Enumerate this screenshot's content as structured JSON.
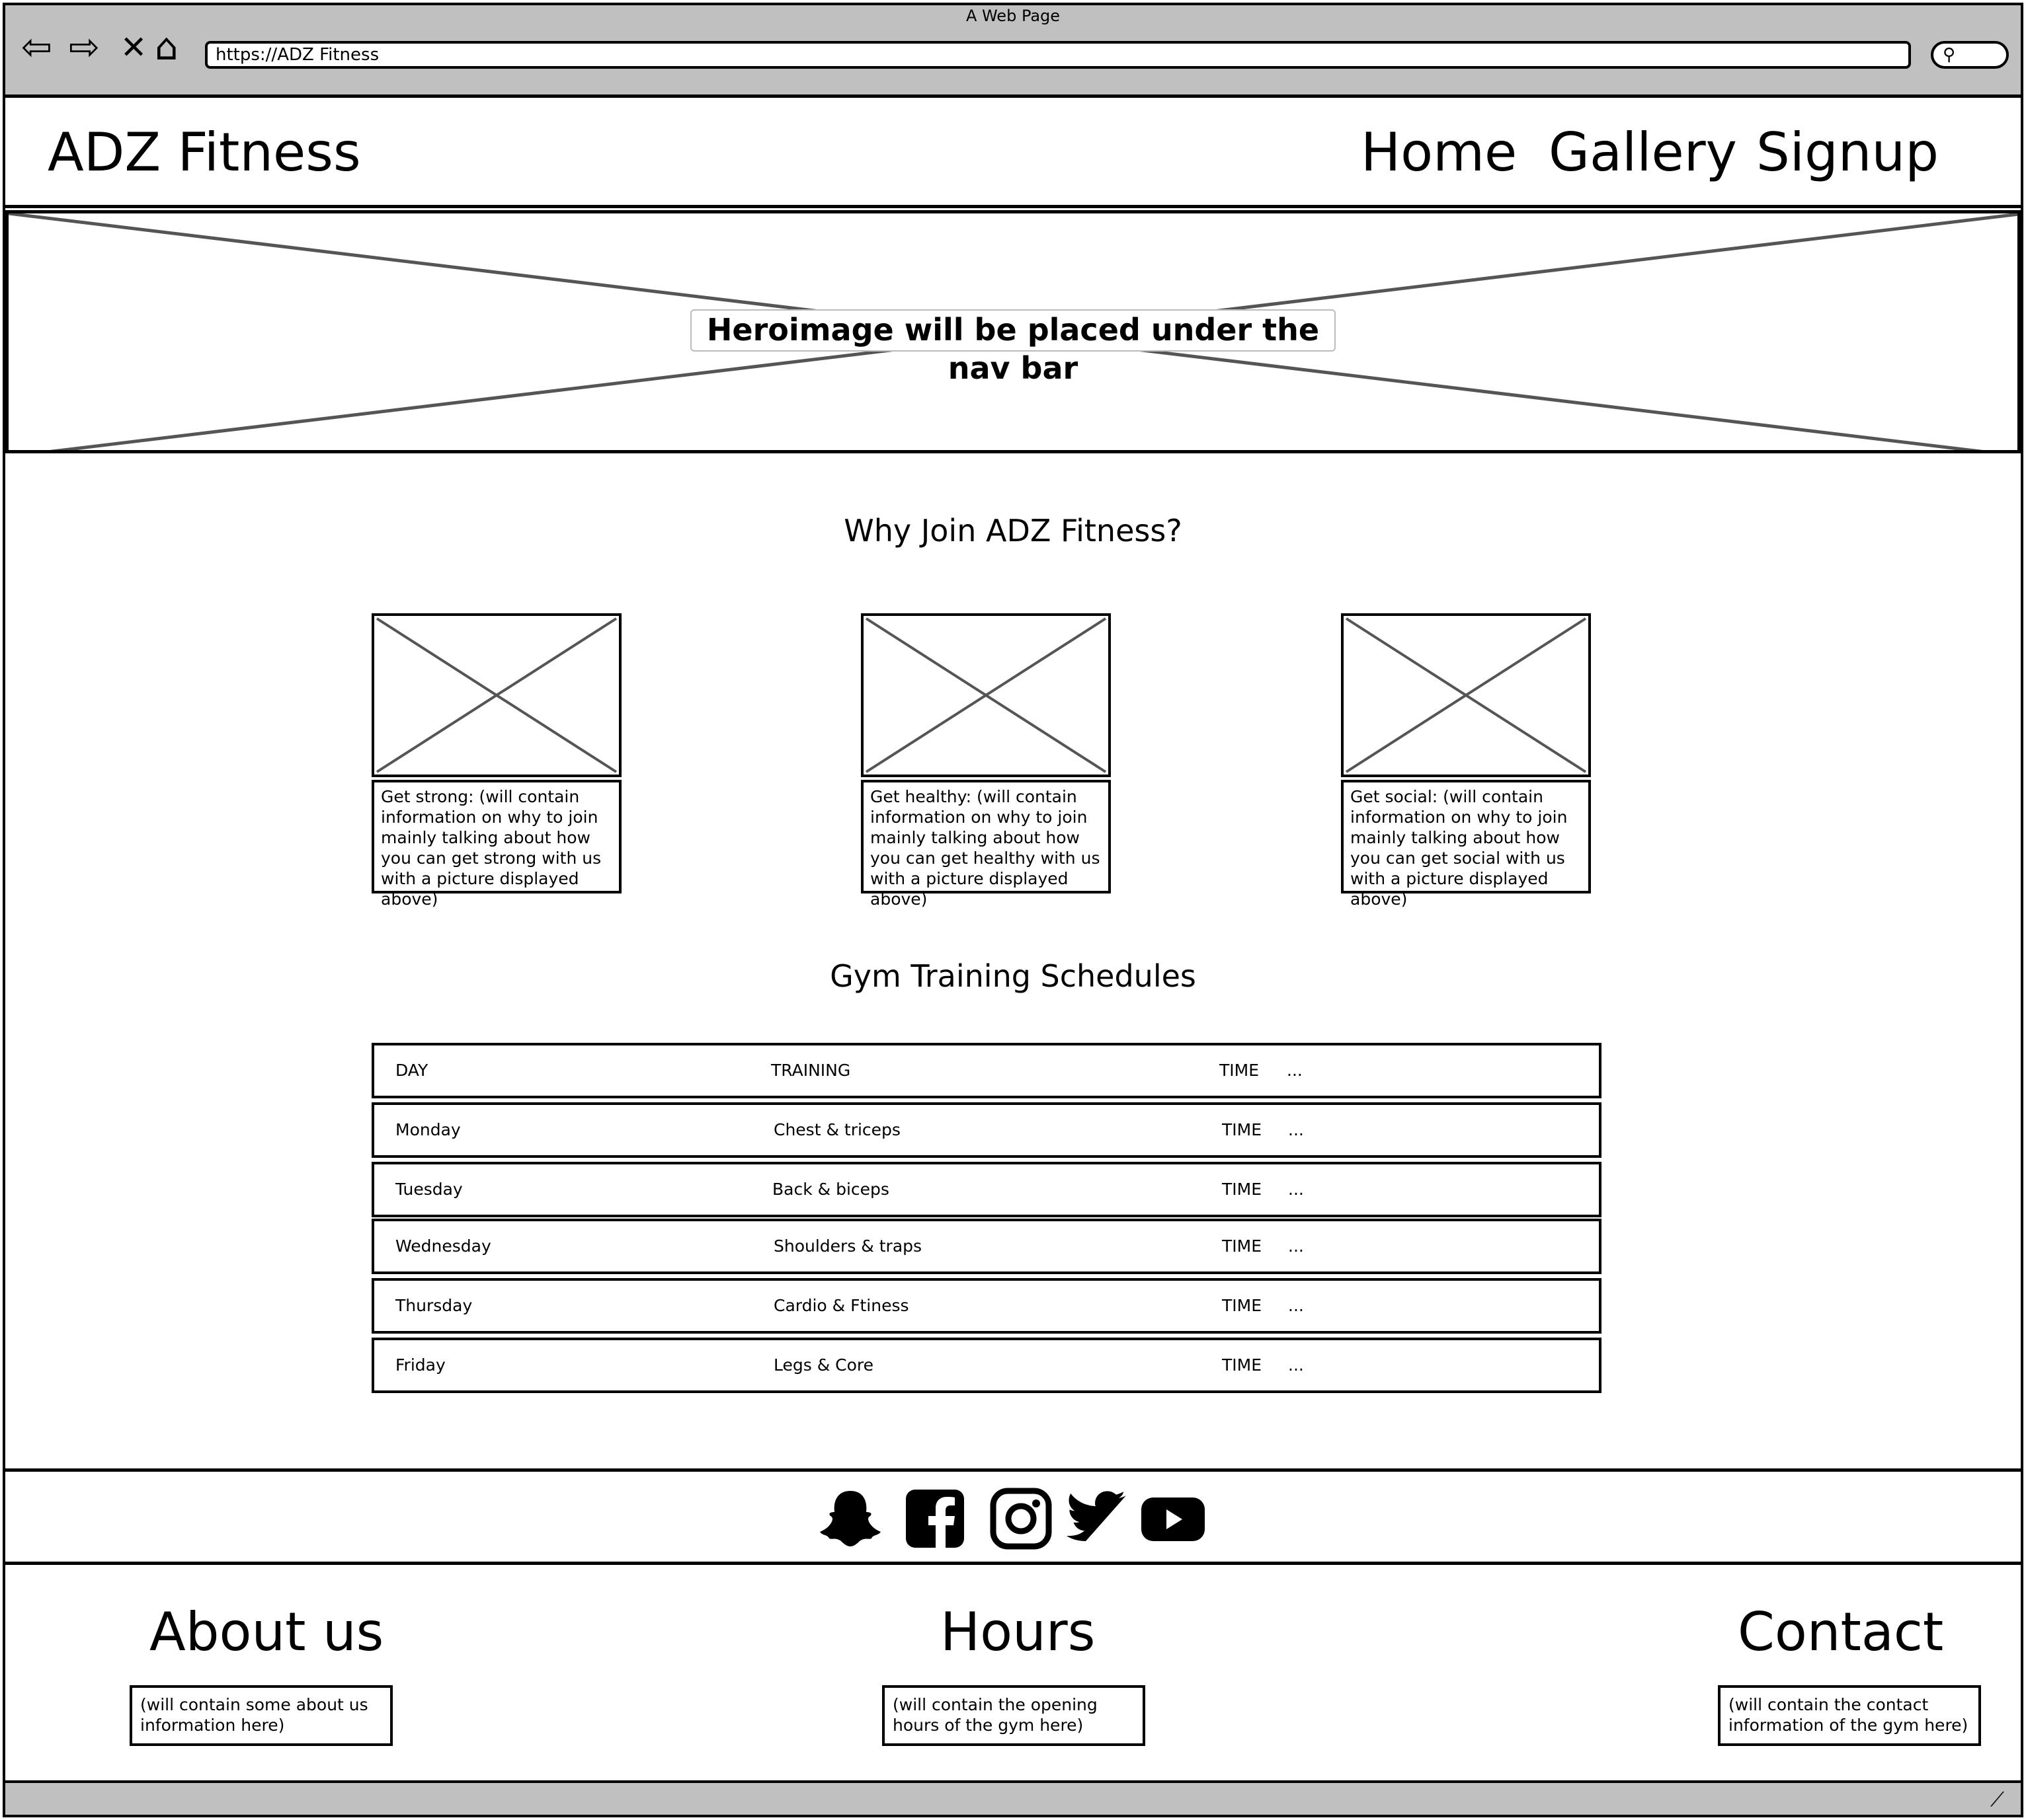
{
  "window": {
    "title": "A Web Page",
    "url": "https://ADZ Fitness"
  },
  "header": {
    "brand": "ADZ Fitness",
    "nav": [
      "Home",
      "Gallery",
      "Signup"
    ]
  },
  "hero": {
    "caption": "Heroimage will be placed under the nav bar"
  },
  "why_join": {
    "title": "Why Join ADZ Fitness?",
    "cards": [
      {
        "text": "Get strong: (will contain information on why to join mainly talking about how you can get strong with us with a picture displayed above)"
      },
      {
        "text": "Get healthy: (will contain information on why to join mainly talking about how you can get healthy with us with a picture displayed above)"
      },
      {
        "text": "Get social: (will contain information on why to join mainly talking about how you can get social with us with a picture displayed above)"
      }
    ]
  },
  "schedule": {
    "title": "Gym Training Schedules",
    "header": {
      "day": "DAY",
      "training": "TRAINING",
      "time": "TIME",
      "more": "..."
    },
    "rows": [
      {
        "day": "Monday",
        "training": "Chest & triceps",
        "time": "TIME",
        "more": "..."
      },
      {
        "day": "Tuesday",
        "training": "Back & biceps",
        "time": "TIME",
        "more": "..."
      },
      {
        "day": "Wednesday",
        "training": "Shoulders & traps",
        "time": "TIME",
        "more": "..."
      },
      {
        "day": "Thursday",
        "training": "Cardio & Ftiness",
        "time": "TIME",
        "more": "..."
      },
      {
        "day": "Friday",
        "training": "Legs & Core",
        "time": "TIME",
        "more": "..."
      }
    ]
  },
  "social": [
    "snapchat-icon",
    "facebook-icon",
    "instagram-icon",
    "twitter-icon",
    "youtube-icon"
  ],
  "footer": {
    "about": {
      "title": "About us",
      "text": "(will contain some about us information here)"
    },
    "hours": {
      "title": "Hours",
      "text": "(will contain the opening hours of the gym here)"
    },
    "contact": {
      "title": "Contact",
      "text": "(will contain the contact information of the gym here)"
    }
  }
}
